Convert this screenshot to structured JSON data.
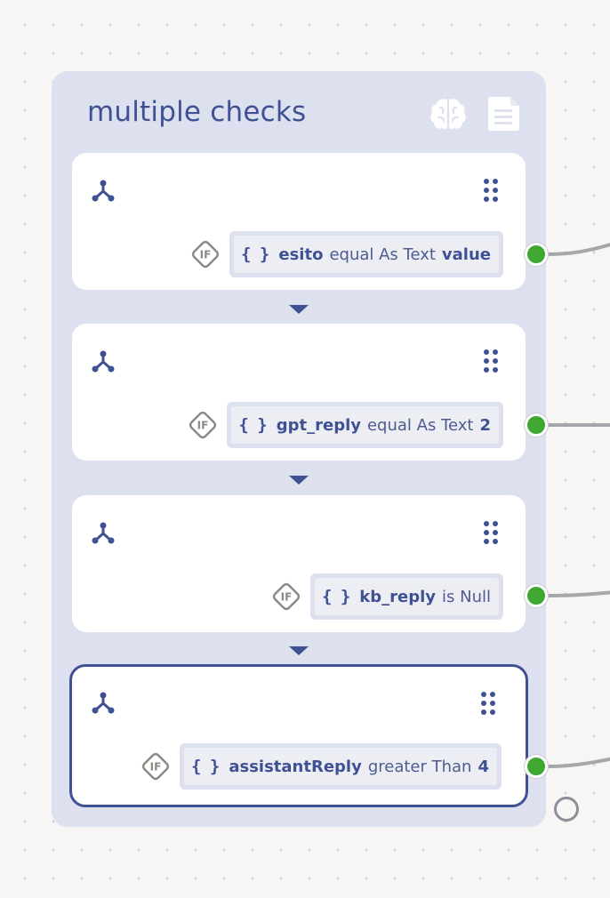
{
  "group": {
    "title": "multiple checks",
    "header_icons": [
      "brain-icon",
      "document-icon"
    ]
  },
  "conditions": [
    {
      "variable": "esito",
      "operator": "equal As Text",
      "value": "value"
    },
    {
      "variable": "gpt_reply",
      "operator": "equal As Text",
      "value": "2"
    },
    {
      "variable": "kb_reply",
      "operator": "is Null",
      "value": ""
    },
    {
      "variable": "assistantReply",
      "operator": "greater Than",
      "value": "4"
    }
  ],
  "selected_card_index": 3,
  "colors": {
    "accent": "#3f5193",
    "group_background": "#dde1ef",
    "port_connected": "#3fa832",
    "edge": "#a6a7ab"
  }
}
